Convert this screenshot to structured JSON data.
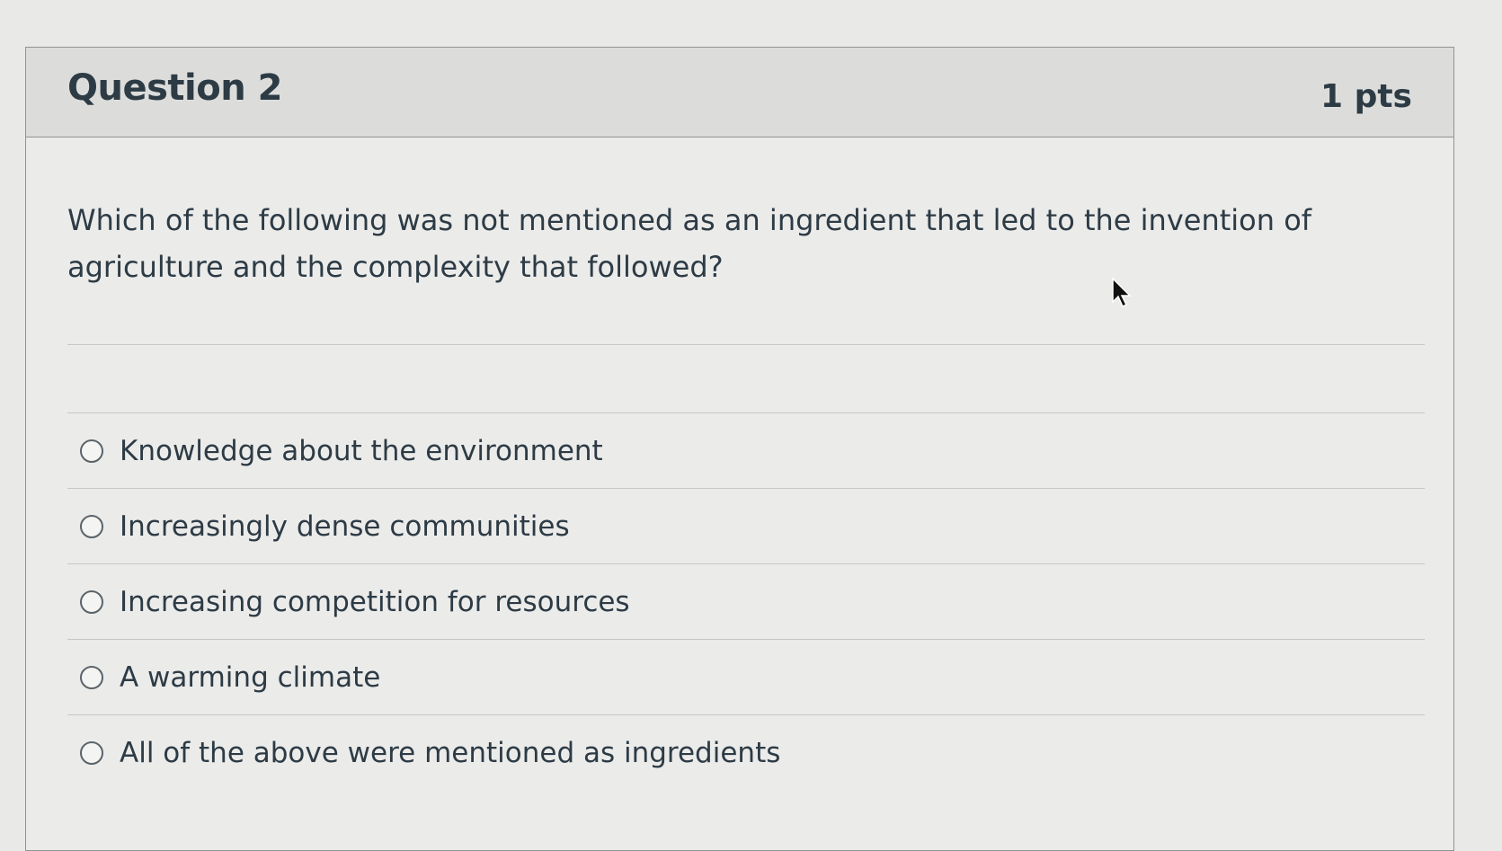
{
  "question": {
    "title": "Question 2",
    "points": "1 pts",
    "text": "Which of the following was not mentioned as an ingredient that led to the invention of agriculture and the complexity that followed?"
  },
  "answers": [
    {
      "label": "Knowledge about the environment",
      "selected": false
    },
    {
      "label": "Increasingly dense communities",
      "selected": false
    },
    {
      "label": "Increasing competition for resources",
      "selected": false
    },
    {
      "label": "A warming climate",
      "selected": false
    },
    {
      "label": "All of the above were mentioned as ingredients",
      "selected": false
    }
  ],
  "icons": {
    "radio": "radio-unchecked-icon",
    "cursor": "mouse-pointer-icon"
  }
}
